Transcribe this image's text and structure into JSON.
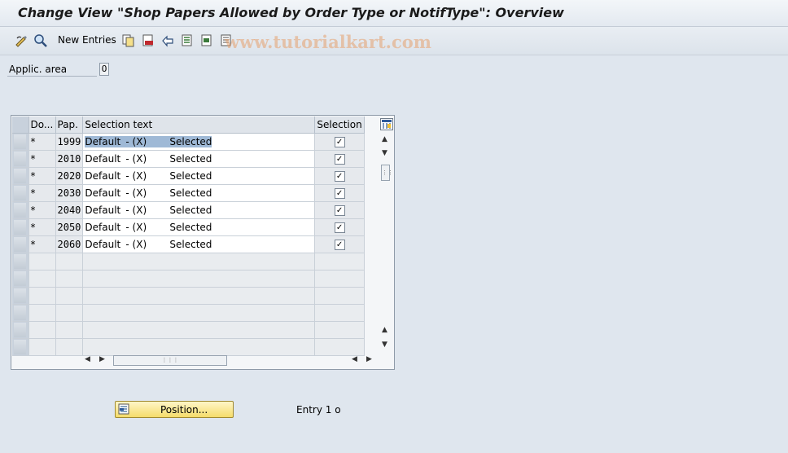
{
  "window": {
    "title": "Change View \"Shop Papers Allowed by Order Type or NotifType\": Overview"
  },
  "toolbar": {
    "new_entries_label": "New Entries",
    "icons": [
      "edit-glasses-icon",
      "display-change-icon",
      "copy-icon",
      "delete-icon",
      "undo-icon",
      "select-all-icon",
      "select-block-icon",
      "deselect-all-icon"
    ]
  },
  "watermark": "www.tutorialkart.com",
  "filter": {
    "label": "Applic. area",
    "value": "O"
  },
  "table": {
    "columns": {
      "do": "Do...",
      "pap": "Pap.",
      "text": "Selection text",
      "selection": "Selection"
    },
    "rows": [
      {
        "do": "*",
        "pap": "1999",
        "text_default": "Default",
        "text_x": "- (X)",
        "text_sel": "Selected",
        "checked": "✓"
      },
      {
        "do": "*",
        "pap": "2010",
        "text_default": "Default",
        "text_x": "- (X)",
        "text_sel": "Selected",
        "checked": "✓"
      },
      {
        "do": "*",
        "pap": "2020",
        "text_default": "Default",
        "text_x": "- (X)",
        "text_sel": "Selected",
        "checked": "✓"
      },
      {
        "do": "*",
        "pap": "2030",
        "text_default": "Default",
        "text_x": "- (X)",
        "text_sel": "Selected",
        "checked": "✓"
      },
      {
        "do": "*",
        "pap": "2040",
        "text_default": "Default",
        "text_x": "- (X)",
        "text_sel": "Selected",
        "checked": "✓"
      },
      {
        "do": "*",
        "pap": "2050",
        "text_default": "Default",
        "text_x": "- (X)",
        "text_sel": "Selected",
        "checked": "✓"
      },
      {
        "do": "*",
        "pap": "2060",
        "text_default": "Default",
        "text_x": "- (X)",
        "text_sel": "Selected",
        "checked": "✓"
      }
    ]
  },
  "footer": {
    "position_button": "Position...",
    "entry_text": "Entry 1 o"
  }
}
